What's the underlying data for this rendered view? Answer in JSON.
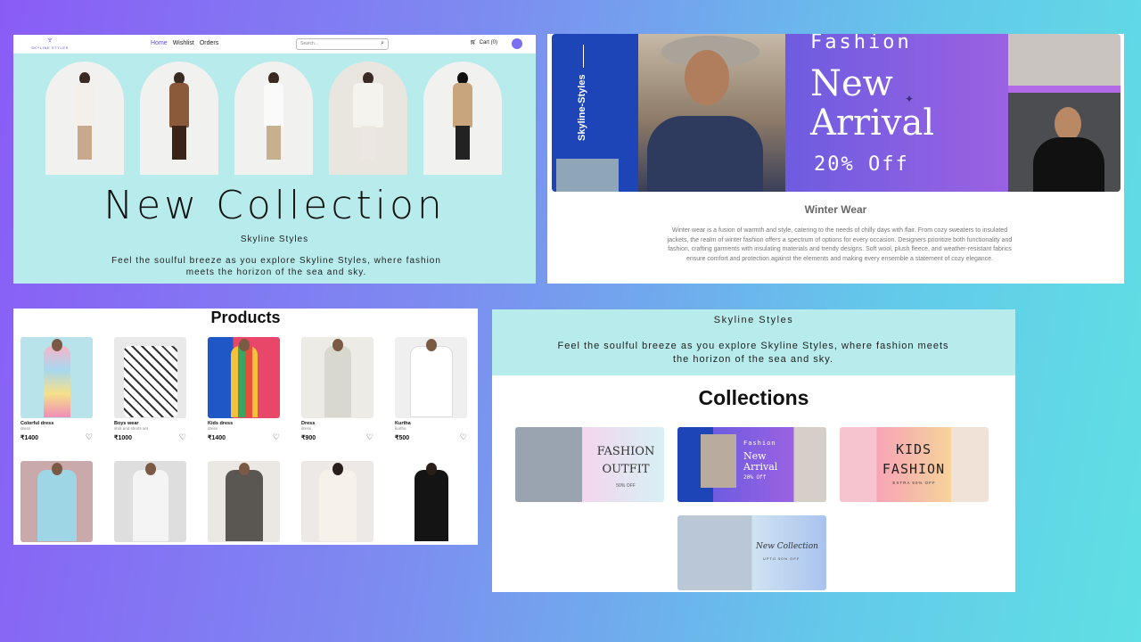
{
  "hero": {
    "logo_text": "SKYLINE STYLES",
    "nav": {
      "home": "Home",
      "wishlist": "Wishlist",
      "orders": "Orders"
    },
    "search_placeholder": "Search...",
    "cart_label": "Cart (0)",
    "title": "New Collection",
    "subtitle": "Skyline Styles",
    "tagline": "Feel the soulful breeze as you explore Skyline Styles, where fashion meets the horizon of the sea and sky."
  },
  "arrival": {
    "side_text": "Skyline-Styles",
    "fashion": "Fashion",
    "new_arrival": "New Arrival",
    "discount": "20% Off",
    "heading": "Winter Wear",
    "description": "Winter wear is a fusion of warmth and style, catering to the needs of chilly days with flair. From cozy sweaters to insulated jackets, the realm of winter fashion offers a spectrum of options for every occasion. Designers prioritize both functionality and fashion, crafting garments with insulating materials and trendy designs. Soft wool, plush fleece, and weather-resistant fabrics ensure comfort and protection against the elements and making every ensemble a statement of cozy elegance."
  },
  "products": {
    "heading": "Products",
    "items": [
      {
        "name": "Colorful dress",
        "category": "dress",
        "price": "₹1400",
        "color": "#f3b6c8"
      },
      {
        "name": "Boys wear",
        "category": "shirt and shorts set",
        "price": "₹1000",
        "color": "#e9e9e9"
      },
      {
        "name": "Kids dress",
        "category": "dress",
        "price": "₹1400",
        "color": "#e84c6a"
      },
      {
        "name": "Dress",
        "category": "dress",
        "price": "₹900",
        "color": "#ecebe6"
      },
      {
        "name": "Kurtha",
        "category": "kurtha",
        "price": "₹500",
        "color": "#f1f1f1"
      },
      {
        "name": "",
        "category": "",
        "price": "",
        "color": "#9fd6e6"
      },
      {
        "name": "",
        "category": "",
        "price": "",
        "color": "#dedede"
      },
      {
        "name": "",
        "category": "",
        "price": "",
        "color": "#ebe7e2"
      },
      {
        "name": "",
        "category": "",
        "price": "",
        "color": "#ece9e6"
      },
      {
        "name": "",
        "category": "",
        "price": "",
        "color": "#ffffff"
      }
    ]
  },
  "collections": {
    "brand": "Skyline Styles",
    "tagline": "Feel the soulful breeze as you explore Skyline Styles, where fashion meets the horizon of the sea and sky.",
    "heading": "Collections",
    "fashion_outfit": "FASHION OUTFIT",
    "fashion_outfit_sub": "50% OFF",
    "arrival_fashion": "Fashion",
    "arrival_new": "New Arrival",
    "arrival_off": "20% Off",
    "kids": "KIDS FASHION",
    "kids_sub": "EXTRA 50% OFF",
    "new_collection": "New Collection",
    "new_collection_sub": "UPTO 50% OFF"
  },
  "colors": {
    "accent": "#5a4fd8",
    "hero_bg": "#b8ecec",
    "arrival_blue": "#1d45b8",
    "arrival_purple": "#9a62e2"
  }
}
